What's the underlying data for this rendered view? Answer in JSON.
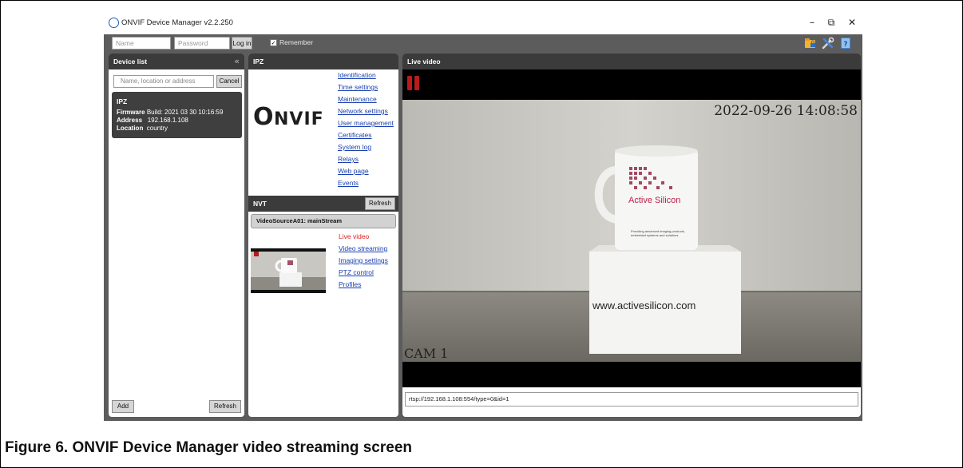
{
  "app": {
    "title": "ONVIF Device Manager v2.2.250",
    "window_controls": {
      "minimize": "–",
      "restore": "⧉",
      "close": "✕"
    }
  },
  "login": {
    "name_placeholder": "Name",
    "password_placeholder": "Password",
    "login_label": "Log in",
    "remember_checked": true,
    "remember_label": "Remember",
    "toolbar_icons": [
      "lock-folder-icon",
      "tools-icon",
      "help-book-icon"
    ]
  },
  "device_list": {
    "header": "Device list",
    "collapse_glyph": "«",
    "search_placeholder": "Name, location or address",
    "cancel_label": "Cancel",
    "device": {
      "name": "IPZ",
      "firmware_key": "Firmware",
      "firmware_value": "Build: 2021 03 30 10:16:59",
      "address_key": "Address",
      "address_value": "192.168.1.108",
      "location_key": "Location",
      "location_value": "country"
    },
    "add_label": "Add",
    "refresh_label": "Refresh"
  },
  "ipz": {
    "header": "IPZ",
    "logo_text": "ONVIF",
    "links": [
      "Identification",
      "Time settings",
      "Maintenance",
      "Network settings",
      "User management",
      "Certificates",
      "System log",
      "Relays",
      "Web page",
      "Events"
    ]
  },
  "nvt": {
    "header": "NVT",
    "refresh_label": "Refresh",
    "stream_title": "VideoSourceA01: mainStream",
    "links": [
      "Live video",
      "Video streaming",
      "Imaging settings",
      "PTZ control",
      "Profiles"
    ],
    "active_link": "Live video"
  },
  "live": {
    "header": "Live video",
    "timestamp": "2022-09-26 14:08:58",
    "camera_name": "CAM 1",
    "mug_brand": "Active Silicon",
    "mug_tagline": "Providing advanced imaging products, embedded systems and solutions",
    "box_url": "www.activesilicon.com",
    "stream_url": "rtsp://192.168.1.108:554/type=0&id=1"
  },
  "caption": "Figure 6.  ONVIF Device Manager video streaming screen",
  "colors": {
    "link": "#1a3fb0",
    "active_link": "#e02020",
    "chrome": "#5c5c5c",
    "header": "#3b3b3b"
  }
}
